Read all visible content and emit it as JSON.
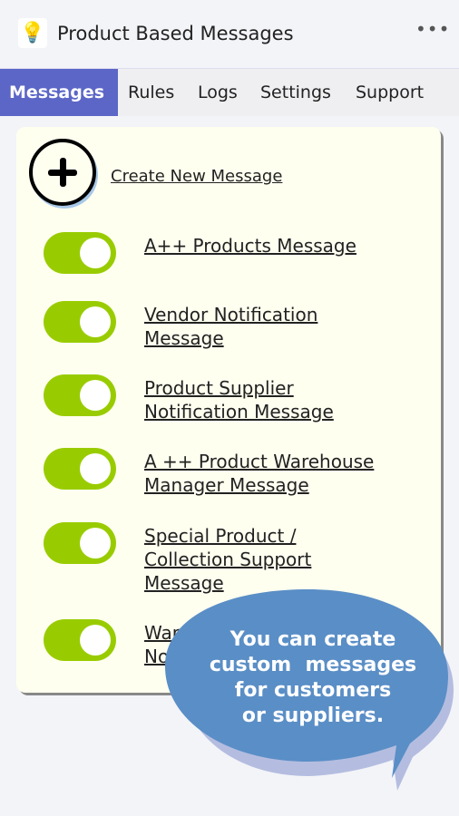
{
  "header": {
    "title": "Product Based Messages",
    "logo_icon": "lightbulb-icon",
    "more_icon": "more-icon"
  },
  "tabs": [
    {
      "label": "Messages",
      "active": true
    },
    {
      "label": "Rules"
    },
    {
      "label": "Logs"
    },
    {
      "label": "Settings"
    },
    {
      "label": "Support"
    }
  ],
  "create_label": "Create New Message",
  "messages": [
    {
      "line1": "A++ Products Message",
      "line2": "",
      "enabled": true
    },
    {
      "line1": "Vendor Notification",
      "line2": "Message",
      "enabled": true
    },
    {
      "line1": "Product Supplier",
      "line2": "Notification Message",
      "enabled": true
    },
    {
      "line1": "A ++ Product Warehouse",
      "line2": "Manager Message",
      "enabled": true
    },
    {
      "line1": "Special Product /",
      "line2": "Collection Support",
      "line3": "Message",
      "enabled": true
    },
    {
      "line1": "Warr",
      "line2": "No",
      "enabled": true
    }
  ],
  "callout": {
    "lines": [
      "You can create",
      "custom  messages",
      "for customers",
      "or suppliers."
    ]
  },
  "colors": {
    "accent": "#5b66c6",
    "toggle_on": "#99cc00",
    "callout": "#5a8ec6"
  }
}
